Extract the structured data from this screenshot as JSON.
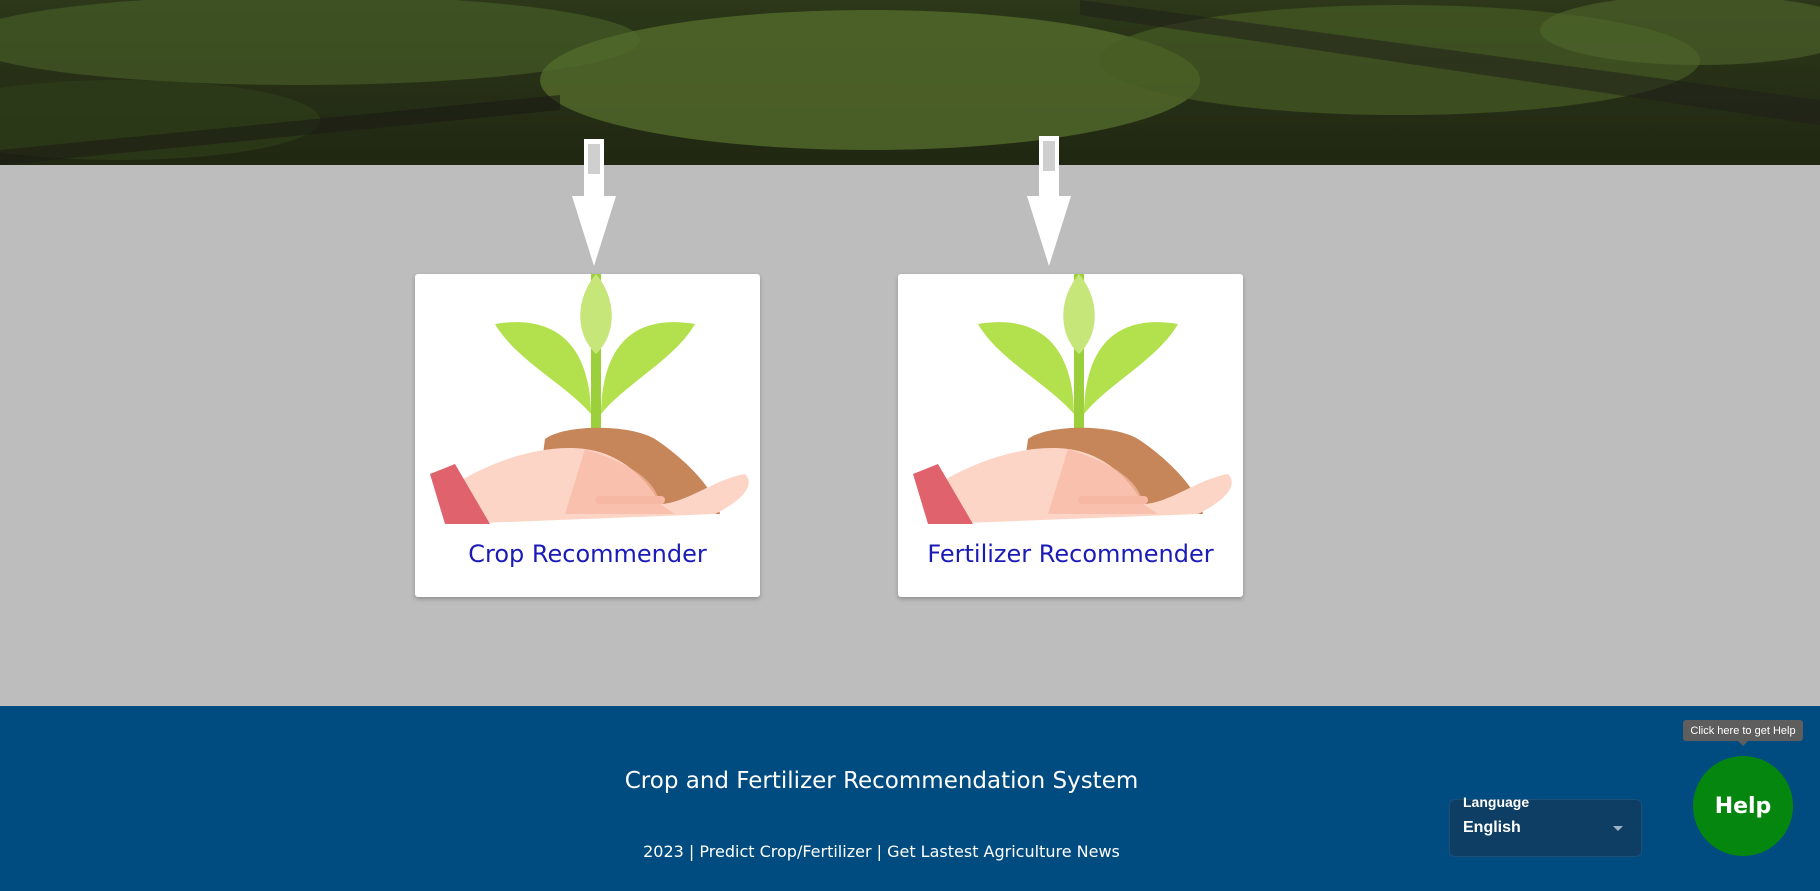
{
  "cards": [
    {
      "label": "Crop Recommender"
    },
    {
      "label": "Fertilizer Recommender"
    }
  ],
  "footer": {
    "title": "Crop and Fertilizer Recommendation System",
    "links": "2023 | Predict Crop/Fertilizer | Get Lastest Agriculture News"
  },
  "language": {
    "label": "Language",
    "selected": "English"
  },
  "help": {
    "label": "Help",
    "tooltip": "Click here to get Help"
  },
  "colors": {
    "footer_bg": "#004b7f",
    "help_bg": "#05870f",
    "card_text": "#1b1bb5"
  }
}
